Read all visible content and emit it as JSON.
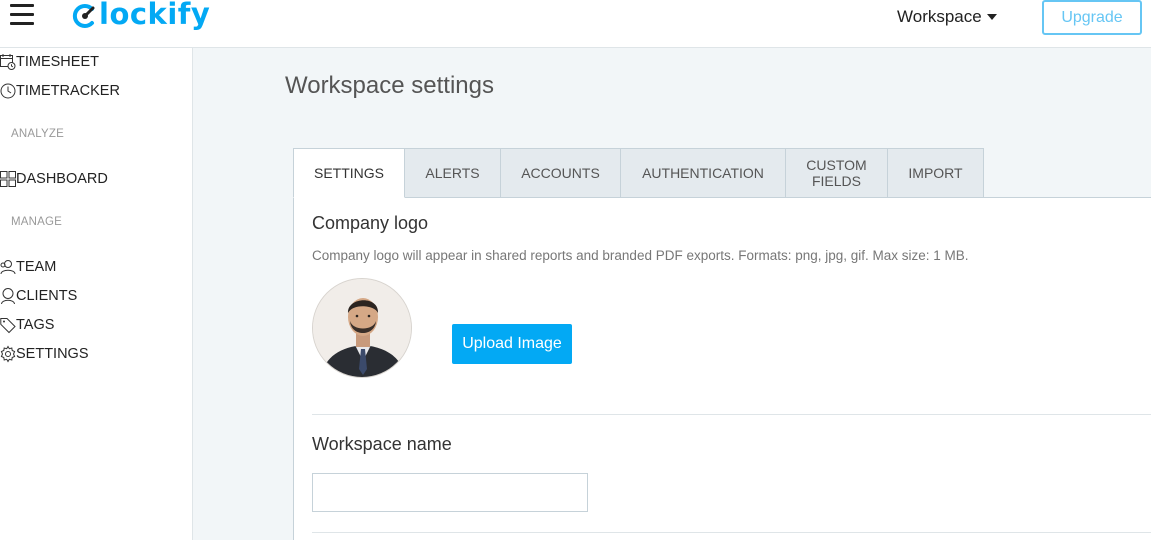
{
  "header": {
    "logo_text": "lockify",
    "workspace_menu_label": "Workspace",
    "upgrade_label": "Upgrade"
  },
  "sidebar": {
    "items_top": [
      {
        "label": "TIMESHEET",
        "icon": "calendar-clock-icon"
      },
      {
        "label": "TIMETRACKER",
        "icon": "clock-icon"
      }
    ],
    "section_analyze": "ANALYZE",
    "items_analyze": [
      {
        "label": "DASHBOARD",
        "icon": "dashboard-grid-icon"
      }
    ],
    "section_manage": "MANAGE",
    "items_manage": [
      {
        "label": "TEAM",
        "icon": "team-icon"
      },
      {
        "label": "CLIENTS",
        "icon": "client-icon"
      },
      {
        "label": "TAGS",
        "icon": "tag-icon"
      },
      {
        "label": "SETTINGS",
        "icon": "gear-icon"
      }
    ]
  },
  "main": {
    "page_title": "Workspace settings",
    "tabs": [
      {
        "label": "SETTINGS",
        "active": true
      },
      {
        "label": "ALERTS",
        "active": false
      },
      {
        "label": "ACCOUNTS",
        "active": false
      },
      {
        "label": "AUTHENTICATION",
        "active": false
      },
      {
        "label": "CUSTOM\nFIELDS",
        "active": false
      },
      {
        "label": "IMPORT",
        "active": false
      }
    ],
    "company_logo": {
      "heading": "Company logo",
      "description": "Company logo will appear in shared reports and branded PDF exports. Formats: png, jpg, gif. Max size: 1 MB.",
      "upload_label": "Upload Image"
    },
    "workspace_name": {
      "heading": "Workspace name",
      "value": ""
    }
  },
  "colors": {
    "accent": "#03a9f4",
    "upgrade_border": "#66c6f4",
    "page_bg": "#f2f6f8",
    "tab_bg": "#e4eaee"
  }
}
